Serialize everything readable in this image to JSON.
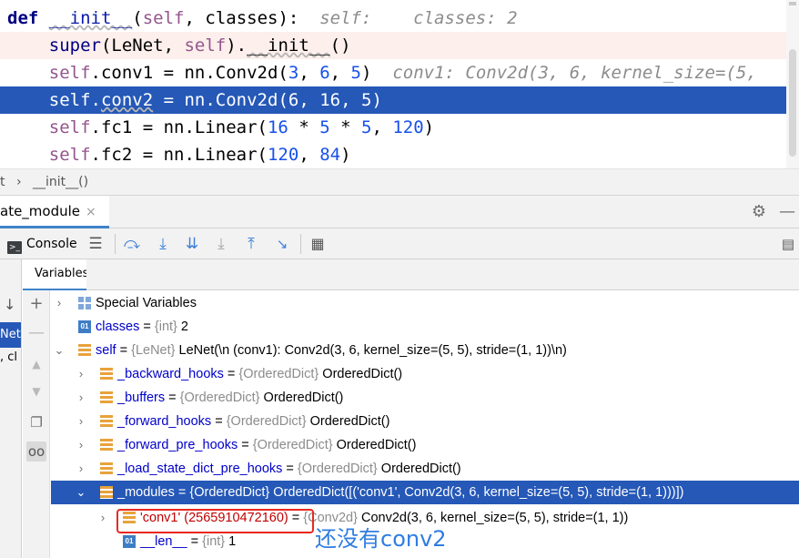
{
  "editor": {
    "lines": [
      {
        "parts": [
          {
            "t": "def ",
            "c": "kw"
          },
          {
            "t": "__init__",
            "c": "fn-sq"
          },
          {
            "t": "(",
            "c": ""
          },
          {
            "t": "self",
            "c": "kw-self"
          },
          {
            "t": ", classes):",
            "c": ""
          },
          {
            "t": "  self:    classes: 2",
            "c": "inline-val"
          }
        ]
      },
      {
        "parts": [
          {
            "t": "    super",
            "c": "builtin"
          },
          {
            "t": "(LeNet, ",
            "c": ""
          },
          {
            "t": "self",
            "c": "kw-self"
          },
          {
            "t": ").",
            "c": ""
          },
          {
            "t": "__init__",
            "c": "sq"
          },
          {
            "t": "()",
            "c": ""
          }
        ]
      },
      {
        "parts": [
          {
            "t": "    self",
            "c": "kw-self"
          },
          {
            "t": ".conv1 = nn.Conv2d(",
            "c": ""
          },
          {
            "t": "3",
            "c": "num"
          },
          {
            "t": ", ",
            "c": ""
          },
          {
            "t": "6",
            "c": "num"
          },
          {
            "t": ", ",
            "c": ""
          },
          {
            "t": "5",
            "c": "num"
          },
          {
            "t": ")",
            "c": ""
          },
          {
            "t": "  conv1: Conv2d(3, 6, kernel_size=(5,",
            "c": "inline-val"
          }
        ]
      },
      {
        "parts": [
          {
            "t": "    self",
            "c": "kw-self"
          },
          {
            "t": ".",
            "c": ""
          },
          {
            "t": "conv2",
            "c": "sq"
          },
          {
            "t": " = nn.Conv2d(",
            "c": ""
          },
          {
            "t": "6",
            "c": "num"
          },
          {
            "t": ", ",
            "c": ""
          },
          {
            "t": "16",
            "c": "num"
          },
          {
            "t": ", ",
            "c": ""
          },
          {
            "t": "5",
            "c": "num"
          },
          {
            "t": ")",
            "c": ""
          }
        ]
      },
      {
        "parts": [
          {
            "t": "    self",
            "c": "kw-self"
          },
          {
            "t": ".fc1 = nn.Linear(",
            "c": ""
          },
          {
            "t": "16",
            "c": "num"
          },
          {
            "t": " * ",
            "c": ""
          },
          {
            "t": "5",
            "c": "num"
          },
          {
            "t": " * ",
            "c": ""
          },
          {
            "t": "5",
            "c": "num"
          },
          {
            "t": ", ",
            "c": ""
          },
          {
            "t": "120",
            "c": "num"
          },
          {
            "t": ")",
            "c": ""
          }
        ]
      },
      {
        "parts": [
          {
            "t": "    self",
            "c": "kw-self"
          },
          {
            "t": ".fc2 = nn.Linear(",
            "c": ""
          },
          {
            "t": "120",
            "c": "num"
          },
          {
            "t": ", ",
            "c": ""
          },
          {
            "t": "84",
            "c": "num"
          },
          {
            "t": ")",
            "c": ""
          }
        ]
      }
    ]
  },
  "breadcrumb": {
    "first": "t",
    "separator": "›",
    "second": "__init__()"
  },
  "debug": {
    "session_tab": "ate_module",
    "session_close": "×",
    "console_label": "Console",
    "variables_tab": "Variables",
    "frames": {
      "selected": "Net",
      "below": ", cl"
    }
  },
  "variables": {
    "special": "Special Variables",
    "classes": {
      "name": "classes",
      "eq": " = ",
      "type": "{int}",
      "value": " 2"
    },
    "self": {
      "name": "self",
      "eq": " = ",
      "type": "{LeNet}",
      "value": " LeNet(\\n  (conv1): Conv2d(3, 6, kernel_size=(5, 5), stride=(1, 1))\\n)"
    },
    "hooks": [
      {
        "name": "_backward_hooks",
        "eq": " = ",
        "type": "{OrderedDict}",
        "value": " OrderedDict()"
      },
      {
        "name": "_buffers",
        "eq": " = ",
        "type": "{OrderedDict}",
        "value": " OrderedDict()"
      },
      {
        "name": "_forward_hooks",
        "eq": " = ",
        "type": "{OrderedDict}",
        "value": " OrderedDict()"
      },
      {
        "name": "_forward_pre_hooks",
        "eq": " = ",
        "type": "{OrderedDict}",
        "value": " OrderedDict()"
      },
      {
        "name": "_load_state_dict_pre_hooks",
        "eq": " = ",
        "type": "{OrderedDict}",
        "value": " OrderedDict()"
      }
    ],
    "modules": {
      "name": "_modules",
      "eq": " = ",
      "type": "{OrderedDict}",
      "value": " OrderedDict([('conv1', Conv2d(3, 6, kernel_size=(5, 5), stride=(1, 1)))])"
    },
    "conv1": {
      "name": "'conv1' (2565910472160)",
      "eq": " = ",
      "type": "{Conv2d}",
      "value": " Conv2d(3, 6, kernel_size=(5, 5), stride=(1, 1))"
    },
    "len": {
      "name": "__len__",
      "eq": " = ",
      "type": "{int}",
      "value": " 1"
    }
  },
  "annotation": "还没有conv2",
  "colors": {
    "selection": "#2558b7",
    "accent": "#4083c9",
    "annotation": "#2f7de1",
    "highlight_box": "#e8281e"
  }
}
